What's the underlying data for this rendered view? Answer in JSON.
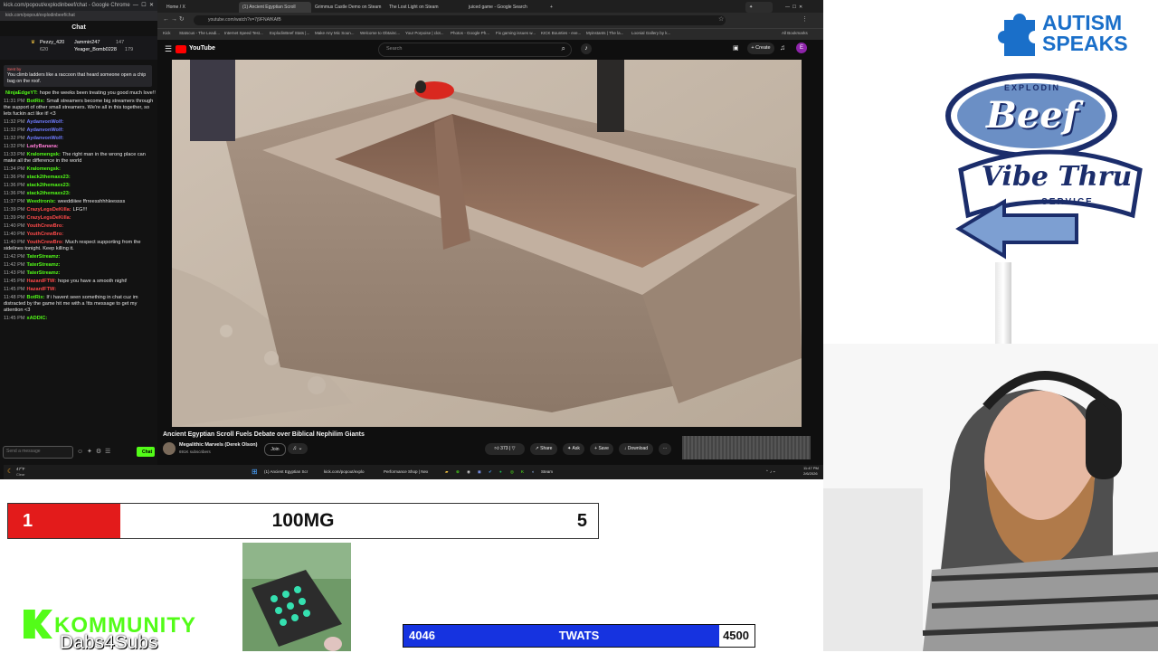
{
  "chat_window": {
    "title": "kick.com/popout/explodinbeef/chat - Google Chrome",
    "url": "kick.com/popout/explodinbeef/chat",
    "header": "Chat",
    "leaderboard": [
      {
        "name": "Pezzy_420",
        "value": "620"
      },
      {
        "name": "Jammin247",
        "value": "147"
      },
      {
        "name": "Yeager_Bomb0228",
        "value": "179"
      }
    ],
    "pinned_label": "Sent by",
    "pinned_text": "You climb ladders like a raccoon that heard someone open a chip bag on the roof.",
    "messages": [
      {
        "time": "",
        "user": "NinjaEdgeYT:",
        "text": "hope the weeks been treating you good much love!!",
        "color": "#53fc18"
      },
      {
        "time": "11:31 PM",
        "user": "BotRix:",
        "text": "Small streamers become big streamers through the support of other small streamers. We're all in this together, so lets fuckin act like it! <3",
        "color": "#53fc18"
      },
      {
        "time": "11:32 PM",
        "user": "AydanvonWolf:",
        "text": "",
        "color": "#6f7bff"
      },
      {
        "time": "11:32 PM",
        "user": "AydanvonWolf:",
        "text": "",
        "color": "#6f7bff"
      },
      {
        "time": "11:32 PM",
        "user": "AydanvonWolf:",
        "text": "",
        "color": "#6f7bff"
      },
      {
        "time": "11:32 PM",
        "user": "LadyBanana:",
        "text": "",
        "color": "#ff7bd6"
      },
      {
        "time": "11:33 PM",
        "user": "Kralomengsk:",
        "text": "The right man in the wrong place can make all the difference in the world",
        "color": "#53fc18"
      },
      {
        "time": "11:34 PM",
        "user": "Kralomengsk:",
        "text": "",
        "color": "#53fc18"
      },
      {
        "time": "11:36 PM",
        "user": "stack2themaxx23:",
        "text": "",
        "color": "#53fc18"
      },
      {
        "time": "11:36 PM",
        "user": "stack2themaxx23:",
        "text": "",
        "color": "#53fc18"
      },
      {
        "time": "11:36 PM",
        "user": "stack2themaxx23:",
        "text": "",
        "color": "#53fc18"
      },
      {
        "time": "11:37 PM",
        "user": "Weedtronix:",
        "text": "weeddiiiee ffrreesshhhleessss",
        "color": "#53fc18"
      },
      {
        "time": "11:39 PM",
        "user": "CrazyLegsDeKilla:",
        "text": "LFG!!!",
        "color": "#ff4a4a"
      },
      {
        "time": "11:39 PM",
        "user": "CrazyLegsDeKilla:",
        "text": "",
        "color": "#ff4a4a"
      },
      {
        "time": "11:40 PM",
        "user": "YouthCrewBro:",
        "text": "",
        "color": "#ff4a4a"
      },
      {
        "time": "11:40 PM",
        "user": "YouthCrewBro:",
        "text": "",
        "color": "#ff4a4a"
      },
      {
        "time": "11:40 PM",
        "user": "YouthCrewBro:",
        "text": "Much respect supporting from the sidelines tonight. Keep killing it.",
        "color": "#ff4a4a"
      },
      {
        "time": "11:42 PM",
        "user": "TaterStreamz:",
        "text": "",
        "color": "#53fc18"
      },
      {
        "time": "11:42 PM",
        "user": "TaterStreamz:",
        "text": "",
        "color": "#53fc18"
      },
      {
        "time": "11:43 PM",
        "user": "TaterStreamz:",
        "text": "",
        "color": "#53fc18"
      },
      {
        "time": "11:45 PM",
        "user": "HazardFTW:",
        "text": "hope you have a smooth night!",
        "color": "#ff4a4a"
      },
      {
        "time": "11:45 PM",
        "user": "HazardFTW:",
        "text": "",
        "color": "#ff4a4a"
      },
      {
        "time": "11:48 PM",
        "user": "BotRix:",
        "text": "If i havent seen something in chat cuz im distracted by the game hit me with a !tts message to get my attention <3",
        "color": "#53fc18"
      },
      {
        "time": "11:45 PM",
        "user": "xADDIC:",
        "text": "",
        "color": "#53fc18"
      }
    ],
    "input_placeholder": "Send a message",
    "send_label": "Chat"
  },
  "browser": {
    "tabs": [
      {
        "label": "Home / X",
        "active": false
      },
      {
        "label": "(1) Ancient Egyptian Scroll",
        "active": true
      },
      {
        "label": "Grimmus Castle Demo on Steam",
        "active": false
      },
      {
        "label": "The Lost Light on Steam",
        "active": false
      },
      {
        "label": "juiced game - Google Search",
        "active": false
      }
    ],
    "new_tab": "+",
    "url": "youtube.com/watch?v=7j9FNAfKAfB",
    "bookmarks": [
      "Kick",
      "Statscus - The Leadi...",
      "Internet Speed Test...",
      "ExplodinBeef Stats |...",
      "Make Any Mic Soun...",
      "Welcome to Obtainc...",
      "Your Porpoise | clot...",
      "Photos - Google Ph...",
      "Fix gaming issues w...",
      "KICK Bounties - eve...",
      "Myinstants | The la...",
      "Loonial Gallery by k...",
      "All Bookmarks"
    ],
    "youtube_logo": "YouTube",
    "search_placeholder": "Search",
    "create_label": "Create",
    "avatar_letter": "E",
    "video_title": "Ancient Egyptian Scroll Fuels Debate over Biblical Nephilim Giants",
    "channel_name": "Megalithic Marvels (Derek Olson)",
    "subscribers": "691K subscribers",
    "join_label": "Join",
    "like_count": "373",
    "share_label": "Share",
    "ask_label": "Ask",
    "save_label": "Save",
    "download_label": "Download",
    "taskbar": {
      "weather_temp": "47°F",
      "weather_cond": "Clear",
      "items": [
        "(1) Ancient Egyptian Scr",
        "kick.com/popout/explo",
        "Performance Shop | Nex",
        "Steam"
      ],
      "time": "11:47 PM",
      "date": "2/6/2026"
    }
  },
  "overlays": {
    "autism_speaks": "AUTISM SPEAKS",
    "beef_top": "EXPLODIN",
    "beef_main": "Beef",
    "beef_sub": "Vibe Thru",
    "beef_service": "SERVICE",
    "score_left": "1",
    "score_title": "100MG",
    "score_right": "5",
    "score_progress": 0.19,
    "kommunity": "KOMMUNITY",
    "dabs": "Dabs4Subs",
    "goal_current": "4046",
    "goal_label": "TWATS",
    "goal_target": "4500",
    "goal_progress": 0.899,
    "colors": {
      "red": "#e31b1b",
      "blue": "#1633e0",
      "kick_green": "#53fc18",
      "autism_blue": "#1a6fc9"
    }
  }
}
